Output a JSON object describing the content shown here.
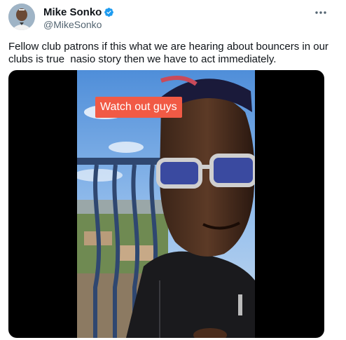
{
  "author": {
    "display_name": "Mike Sonko",
    "handle": "@MikeSonko",
    "verified": true
  },
  "tweet": {
    "text": "Fellow club patrons if this what we are hearing about bouncers in our clubs is true  nasio story then we have to act immediately."
  },
  "media": {
    "caption": "Watch out guys"
  },
  "icons": {
    "verified": "verified-badge-icon",
    "more": "more-options-icon"
  },
  "colors": {
    "verified": "#1d9bf0",
    "caption_bg": "#f15a45",
    "text": "#0f1419",
    "secondary_text": "#536471"
  }
}
